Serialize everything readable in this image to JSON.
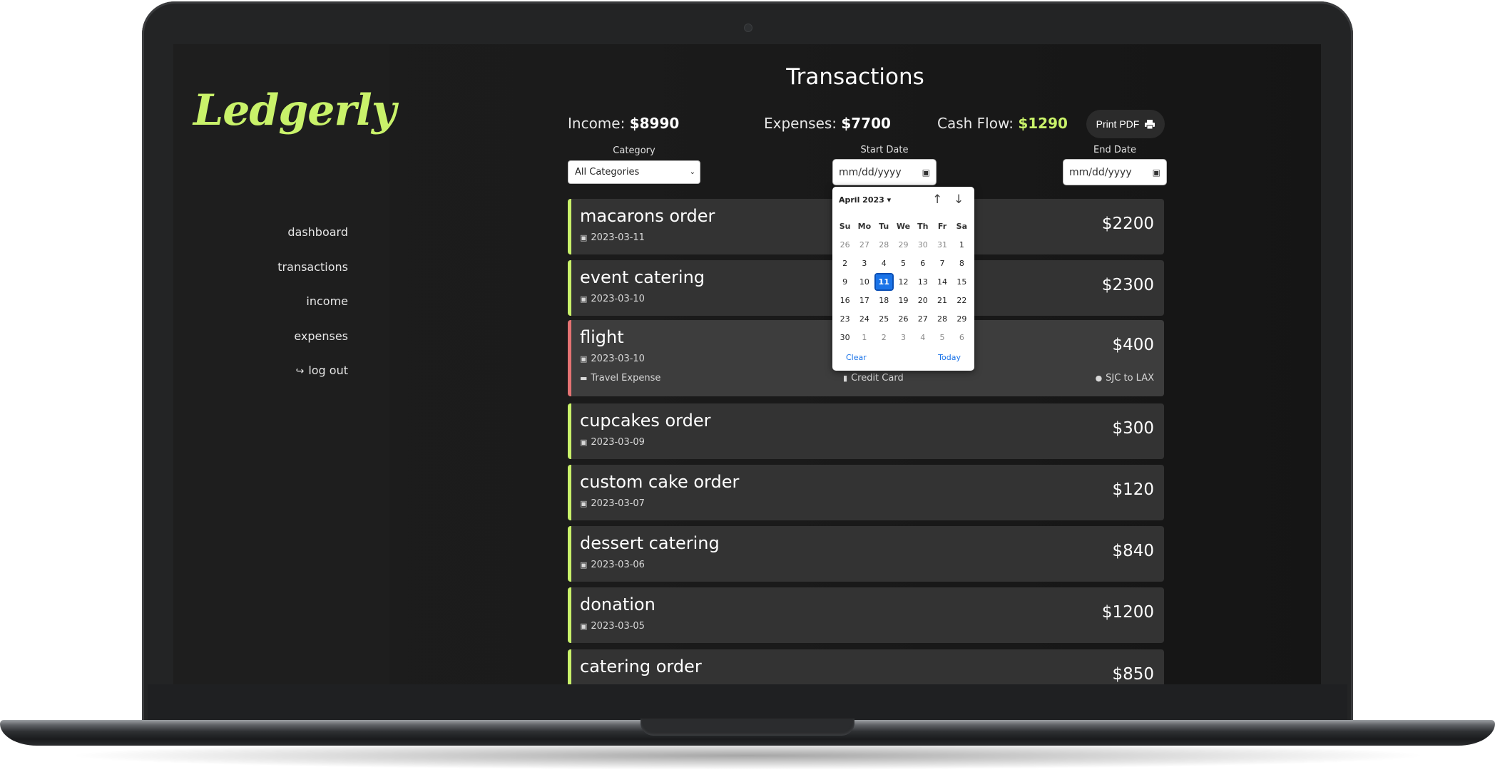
{
  "app": {
    "logo": "Ledgerly"
  },
  "sidebar": {
    "items": [
      {
        "label": "dashboard"
      },
      {
        "label": "transactions"
      },
      {
        "label": "income"
      },
      {
        "label": "expenses"
      },
      {
        "label": "log out"
      }
    ]
  },
  "page": {
    "title": "Transactions"
  },
  "summary": {
    "income_label": "Income:",
    "income_value": "$8990",
    "expenses_label": "Expenses:",
    "expenses_value": "$7700",
    "cashflow_label": "Cash Flow:",
    "cashflow_value": "$1290",
    "print_label": "Print PDF"
  },
  "filters": {
    "category_label": "Category",
    "category_value": "All Categories",
    "start_label": "Start Date",
    "start_placeholder": "mm/dd/yyyy",
    "end_label": "End Date",
    "end_placeholder": "mm/dd/yyyy"
  },
  "transactions": [
    {
      "title": "macarons order",
      "date": "2023-03-11",
      "amount": "$2200"
    },
    {
      "title": "event catering",
      "date": "2023-03-10",
      "amount": "$2300"
    },
    {
      "title": "flight",
      "date": "2023-03-10",
      "amount": "$400",
      "category": "Travel Expense",
      "method": "Credit Card",
      "note": "SJC to LAX"
    },
    {
      "title": "cupcakes order",
      "date": "2023-03-09",
      "amount": "$300"
    },
    {
      "title": "custom cake order",
      "date": "2023-03-07",
      "amount": "$120"
    },
    {
      "title": "dessert catering",
      "date": "2023-03-06",
      "amount": "$840"
    },
    {
      "title": "donation",
      "date": "2023-03-05",
      "amount": "$1200"
    },
    {
      "title": "catering order",
      "date": "",
      "amount": "$850"
    }
  ],
  "datepicker": {
    "month": "April 2023",
    "weekdays": [
      "Su",
      "Mo",
      "Tu",
      "We",
      "Th",
      "Fr",
      "Sa"
    ],
    "weeks": [
      [
        "26",
        "27",
        "28",
        "29",
        "30",
        "31",
        "1"
      ],
      [
        "2",
        "3",
        "4",
        "5",
        "6",
        "7",
        "8"
      ],
      [
        "9",
        "10",
        "11",
        "12",
        "13",
        "14",
        "15"
      ],
      [
        "16",
        "17",
        "18",
        "19",
        "20",
        "21",
        "22"
      ],
      [
        "23",
        "24",
        "25",
        "26",
        "27",
        "28",
        "29"
      ],
      [
        "30",
        "1",
        "2",
        "3",
        "4",
        "5",
        "6"
      ]
    ],
    "selected": "11",
    "clear_label": "Clear",
    "today_label": "Today"
  },
  "colors": {
    "accent": "#c9f26a",
    "expense": "#e57373",
    "selected_day": "#1a73e8"
  }
}
